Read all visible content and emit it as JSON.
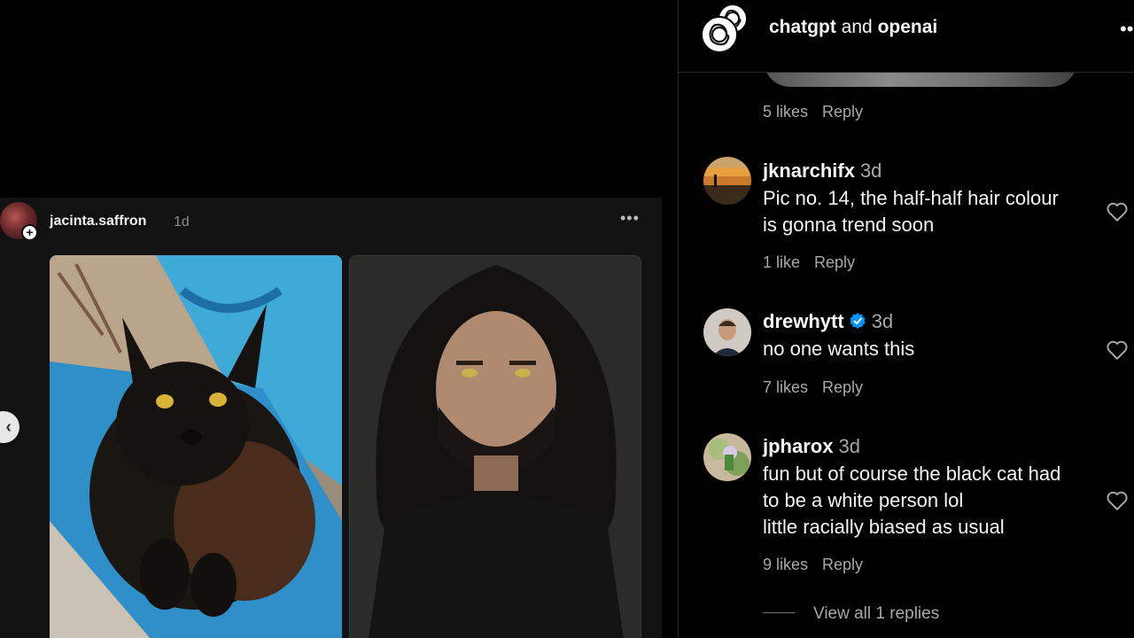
{
  "post": {
    "username": "jacinta.saffron",
    "time": "1d",
    "more_icon": "more-horizontal-icon"
  },
  "header": {
    "account1": "chatgpt",
    "joiner": "and",
    "account2": "openai",
    "more_icon": "more-horizontal-icon"
  },
  "top_comment_meta": {
    "likes": "5 likes",
    "reply": "Reply"
  },
  "comments": [
    {
      "username": "jknarchifx",
      "time": "3d",
      "lines": [
        "Pic no. 14, the half-half hair colour",
        "is gonna trend soon"
      ],
      "likes": "1 like",
      "reply": "Reply"
    },
    {
      "username": "drewhytt",
      "verified": true,
      "time": "3d",
      "lines": [
        "no one wants this"
      ],
      "likes": "7 likes",
      "reply": "Reply"
    },
    {
      "username": "jpharox",
      "time": "3d",
      "lines": [
        "fun but of course the black cat had",
        "to be a white person lol",
        "little racially biased as usual"
      ],
      "likes": "9 likes",
      "reply": "Reply"
    }
  ],
  "view_replies": "View all 1 replies",
  "colors": {
    "verified": "#0095f6",
    "panel_bg": "#000000",
    "embed_bg": "#121212"
  }
}
